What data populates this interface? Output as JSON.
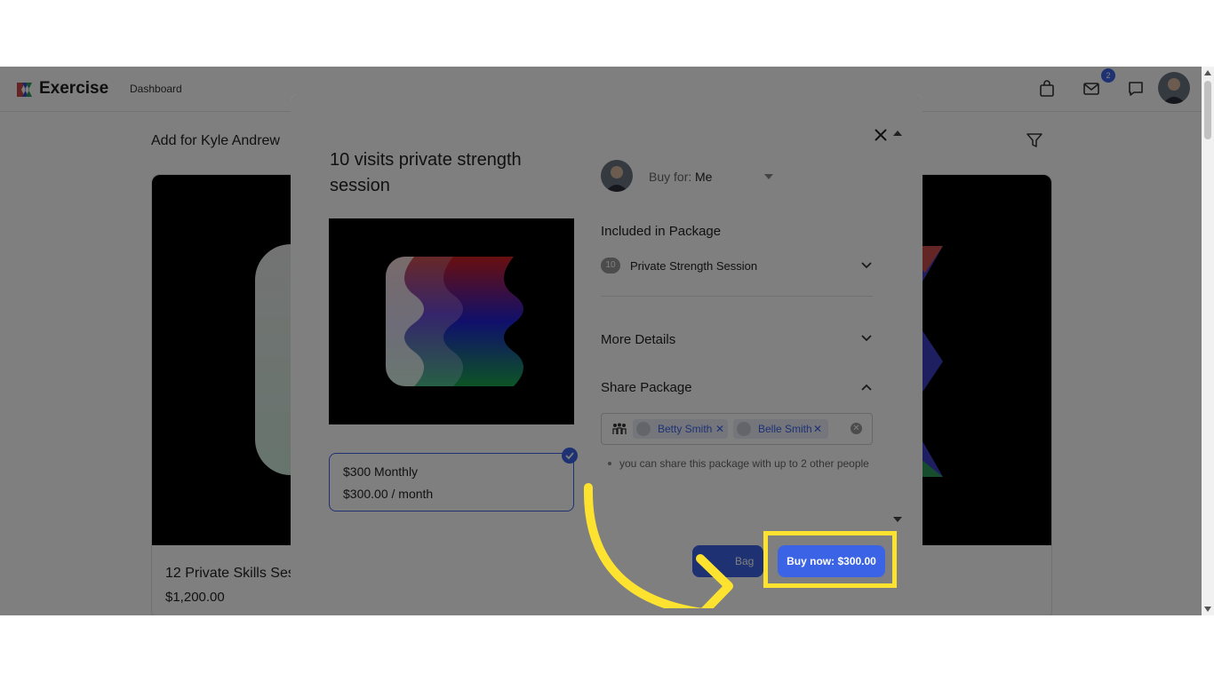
{
  "app": {
    "brand": "Exercise",
    "nav_dashboard": "Dashboard",
    "notification_count": "2"
  },
  "page": {
    "heading": "Add for Kyle Andrew"
  },
  "card": {
    "title": "12 Private Skills Ses",
    "price": "$1,200.00"
  },
  "modal": {
    "title": "10 visits private strength session",
    "buy_for_label": "Buy for:",
    "buy_for_value": "Me",
    "included_heading": "Included in Package",
    "included_count": "10",
    "included_item": "Private Strength Session",
    "more_details": "More Details",
    "share_heading": "Share Package",
    "shared_with": [
      "Betty Smith",
      "Belle Smith"
    ],
    "share_hint": "you can share this package with up to 2 other people",
    "price_option": {
      "name": "$300 Monthly",
      "amount": "$300.00 / month"
    },
    "bag_button": "Bag",
    "buy_button": "Buy now: $300.00"
  },
  "colors": {
    "accent": "#3b63e6",
    "highlight": "#fde330"
  },
  "icons": [
    "logo-icon",
    "shopping-bag-icon",
    "mail-icon",
    "chat-icon",
    "filter-icon",
    "close-icon",
    "chevron-down-icon",
    "chevron-up-icon",
    "people-icon",
    "check-icon"
  ]
}
